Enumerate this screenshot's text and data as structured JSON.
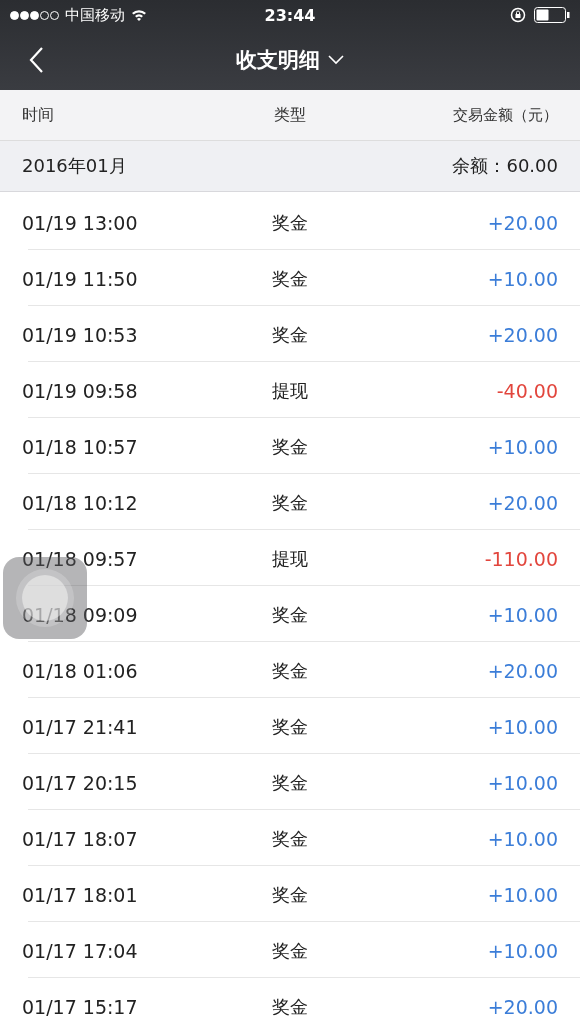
{
  "status_bar": {
    "signal_dots": [
      {
        "filled": true
      },
      {
        "filled": true
      },
      {
        "filled": true
      },
      {
        "filled": false
      },
      {
        "filled": false
      }
    ],
    "carrier": "中国移动",
    "time": "23:44"
  },
  "nav": {
    "title": "收支明细"
  },
  "columns": [
    "时间",
    "类型",
    "交易金额（元）"
  ],
  "month": {
    "label": "2016年01月",
    "balance": "余额：60.00"
  },
  "rows": [
    {
      "time": "01/19 13:00",
      "type": "奖金",
      "amount": "+20.00",
      "kind": "income"
    },
    {
      "time": "01/19 11:50",
      "type": "奖金",
      "amount": "+10.00",
      "kind": "income"
    },
    {
      "time": "01/19 10:53",
      "type": "奖金",
      "amount": "+20.00",
      "kind": "income"
    },
    {
      "time": "01/19 09:58",
      "type": "提现",
      "amount": "-40.00",
      "kind": "expense"
    },
    {
      "time": "01/18 10:57",
      "type": "奖金",
      "amount": "+10.00",
      "kind": "income"
    },
    {
      "time": "01/18 10:12",
      "type": "奖金",
      "amount": "+20.00",
      "kind": "income"
    },
    {
      "time": "01/18 09:57",
      "type": "提现",
      "amount": "-110.00",
      "kind": "expense"
    },
    {
      "time": "01/18 09:09",
      "type": "奖金",
      "amount": "+10.00",
      "kind": "income"
    },
    {
      "time": "01/18 01:06",
      "type": "奖金",
      "amount": "+20.00",
      "kind": "income"
    },
    {
      "time": "01/17 21:41",
      "type": "奖金",
      "amount": "+10.00",
      "kind": "income"
    },
    {
      "time": "01/17 20:15",
      "type": "奖金",
      "amount": "+10.00",
      "kind": "income"
    },
    {
      "time": "01/17 18:07",
      "type": "奖金",
      "amount": "+10.00",
      "kind": "income"
    },
    {
      "time": "01/17 18:01",
      "type": "奖金",
      "amount": "+10.00",
      "kind": "income"
    },
    {
      "time": "01/17 17:04",
      "type": "奖金",
      "amount": "+10.00",
      "kind": "income"
    },
    {
      "time": "01/17 15:17",
      "type": "奖金",
      "amount": "+20.00",
      "kind": "income"
    }
  ]
}
